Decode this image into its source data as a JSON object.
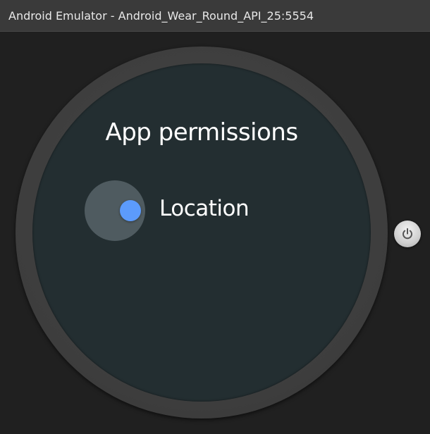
{
  "window": {
    "title": "Android Emulator - Android_Wear_Round_API_25:5554"
  },
  "watch": {
    "screen_title": "App permissions",
    "permissions": [
      {
        "label": "Location",
        "enabled": true
      }
    ]
  },
  "controls": {
    "power_icon": "power-icon"
  },
  "colors": {
    "titlebar": "#3a3a3a",
    "window_bg": "#202020",
    "bezel": "#3f3f3f",
    "screen_bg": "#232e31",
    "toggle_accent": "#5c9bfc",
    "toggle_halo": "#4f5b60"
  }
}
